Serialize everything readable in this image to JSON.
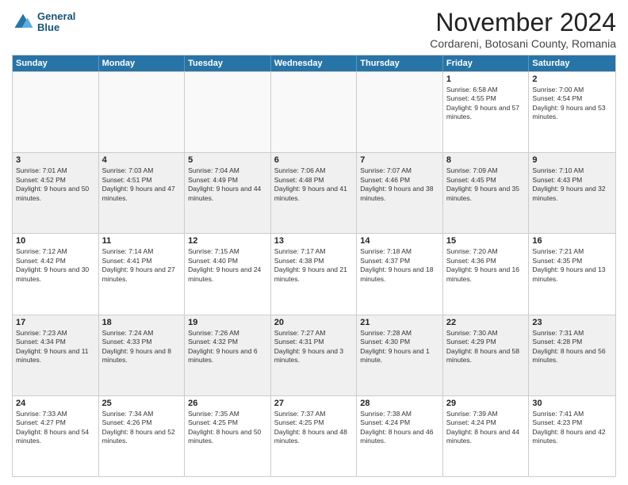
{
  "logo": {
    "line1": "General",
    "line2": "Blue"
  },
  "title": "November 2024",
  "location": "Cordareni, Botosani County, Romania",
  "days_of_week": [
    "Sunday",
    "Monday",
    "Tuesday",
    "Wednesday",
    "Thursday",
    "Friday",
    "Saturday"
  ],
  "weeks": [
    [
      {
        "day": "",
        "empty": true
      },
      {
        "day": "",
        "empty": true
      },
      {
        "day": "",
        "empty": true
      },
      {
        "day": "",
        "empty": true
      },
      {
        "day": "",
        "empty": true
      },
      {
        "day": "1",
        "sunrise": "Sunrise: 6:58 AM",
        "sunset": "Sunset: 4:55 PM",
        "daylight": "Daylight: 9 hours and 57 minutes."
      },
      {
        "day": "2",
        "sunrise": "Sunrise: 7:00 AM",
        "sunset": "Sunset: 4:54 PM",
        "daylight": "Daylight: 9 hours and 53 minutes."
      }
    ],
    [
      {
        "day": "3",
        "sunrise": "Sunrise: 7:01 AM",
        "sunset": "Sunset: 4:52 PM",
        "daylight": "Daylight: 9 hours and 50 minutes."
      },
      {
        "day": "4",
        "sunrise": "Sunrise: 7:03 AM",
        "sunset": "Sunset: 4:51 PM",
        "daylight": "Daylight: 9 hours and 47 minutes."
      },
      {
        "day": "5",
        "sunrise": "Sunrise: 7:04 AM",
        "sunset": "Sunset: 4:49 PM",
        "daylight": "Daylight: 9 hours and 44 minutes."
      },
      {
        "day": "6",
        "sunrise": "Sunrise: 7:06 AM",
        "sunset": "Sunset: 4:48 PM",
        "daylight": "Daylight: 9 hours and 41 minutes."
      },
      {
        "day": "7",
        "sunrise": "Sunrise: 7:07 AM",
        "sunset": "Sunset: 4:46 PM",
        "daylight": "Daylight: 9 hours and 38 minutes."
      },
      {
        "day": "8",
        "sunrise": "Sunrise: 7:09 AM",
        "sunset": "Sunset: 4:45 PM",
        "daylight": "Daylight: 9 hours and 35 minutes."
      },
      {
        "day": "9",
        "sunrise": "Sunrise: 7:10 AM",
        "sunset": "Sunset: 4:43 PM",
        "daylight": "Daylight: 9 hours and 32 minutes."
      }
    ],
    [
      {
        "day": "10",
        "sunrise": "Sunrise: 7:12 AM",
        "sunset": "Sunset: 4:42 PM",
        "daylight": "Daylight: 9 hours and 30 minutes."
      },
      {
        "day": "11",
        "sunrise": "Sunrise: 7:14 AM",
        "sunset": "Sunset: 4:41 PM",
        "daylight": "Daylight: 9 hours and 27 minutes."
      },
      {
        "day": "12",
        "sunrise": "Sunrise: 7:15 AM",
        "sunset": "Sunset: 4:40 PM",
        "daylight": "Daylight: 9 hours and 24 minutes."
      },
      {
        "day": "13",
        "sunrise": "Sunrise: 7:17 AM",
        "sunset": "Sunset: 4:38 PM",
        "daylight": "Daylight: 9 hours and 21 minutes."
      },
      {
        "day": "14",
        "sunrise": "Sunrise: 7:18 AM",
        "sunset": "Sunset: 4:37 PM",
        "daylight": "Daylight: 9 hours and 18 minutes."
      },
      {
        "day": "15",
        "sunrise": "Sunrise: 7:20 AM",
        "sunset": "Sunset: 4:36 PM",
        "daylight": "Daylight: 9 hours and 16 minutes."
      },
      {
        "day": "16",
        "sunrise": "Sunrise: 7:21 AM",
        "sunset": "Sunset: 4:35 PM",
        "daylight": "Daylight: 9 hours and 13 minutes."
      }
    ],
    [
      {
        "day": "17",
        "sunrise": "Sunrise: 7:23 AM",
        "sunset": "Sunset: 4:34 PM",
        "daylight": "Daylight: 9 hours and 11 minutes."
      },
      {
        "day": "18",
        "sunrise": "Sunrise: 7:24 AM",
        "sunset": "Sunset: 4:33 PM",
        "daylight": "Daylight: 9 hours and 8 minutes."
      },
      {
        "day": "19",
        "sunrise": "Sunrise: 7:26 AM",
        "sunset": "Sunset: 4:32 PM",
        "daylight": "Daylight: 9 hours and 6 minutes."
      },
      {
        "day": "20",
        "sunrise": "Sunrise: 7:27 AM",
        "sunset": "Sunset: 4:31 PM",
        "daylight": "Daylight: 9 hours and 3 minutes."
      },
      {
        "day": "21",
        "sunrise": "Sunrise: 7:28 AM",
        "sunset": "Sunset: 4:30 PM",
        "daylight": "Daylight: 9 hours and 1 minute."
      },
      {
        "day": "22",
        "sunrise": "Sunrise: 7:30 AM",
        "sunset": "Sunset: 4:29 PM",
        "daylight": "Daylight: 8 hours and 58 minutes."
      },
      {
        "day": "23",
        "sunrise": "Sunrise: 7:31 AM",
        "sunset": "Sunset: 4:28 PM",
        "daylight": "Daylight: 8 hours and 56 minutes."
      }
    ],
    [
      {
        "day": "24",
        "sunrise": "Sunrise: 7:33 AM",
        "sunset": "Sunset: 4:27 PM",
        "daylight": "Daylight: 8 hours and 54 minutes."
      },
      {
        "day": "25",
        "sunrise": "Sunrise: 7:34 AM",
        "sunset": "Sunset: 4:26 PM",
        "daylight": "Daylight: 8 hours and 52 minutes."
      },
      {
        "day": "26",
        "sunrise": "Sunrise: 7:35 AM",
        "sunset": "Sunset: 4:25 PM",
        "daylight": "Daylight: 8 hours and 50 minutes."
      },
      {
        "day": "27",
        "sunrise": "Sunrise: 7:37 AM",
        "sunset": "Sunset: 4:25 PM",
        "daylight": "Daylight: 8 hours and 48 minutes."
      },
      {
        "day": "28",
        "sunrise": "Sunrise: 7:38 AM",
        "sunset": "Sunset: 4:24 PM",
        "daylight": "Daylight: 8 hours and 46 minutes."
      },
      {
        "day": "29",
        "sunrise": "Sunrise: 7:39 AM",
        "sunset": "Sunset: 4:24 PM",
        "daylight": "Daylight: 8 hours and 44 minutes."
      },
      {
        "day": "30",
        "sunrise": "Sunrise: 7:41 AM",
        "sunset": "Sunset: 4:23 PM",
        "daylight": "Daylight: 8 hours and 42 minutes."
      }
    ]
  ]
}
